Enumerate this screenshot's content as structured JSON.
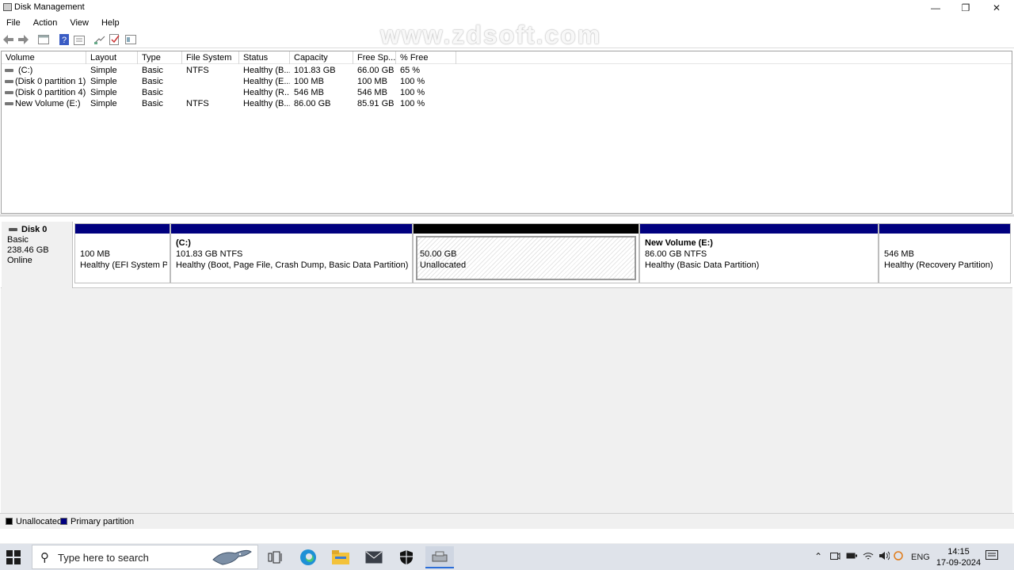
{
  "window": {
    "title": "Disk Management",
    "minimize": "—",
    "restore": "❐",
    "close": "✕"
  },
  "menu": [
    "File",
    "Action",
    "View",
    "Help"
  ],
  "watermark": "www.zdsoft.com",
  "volume_table": {
    "columns": [
      "Volume",
      "Layout",
      "Type",
      "File System",
      "Status",
      "Capacity",
      "Free Sp...",
      "% Free"
    ],
    "rows": [
      {
        "volume": "(C:)",
        "layout": "Simple",
        "type": "Basic",
        "fs": "NTFS",
        "status": "Healthy (B...",
        "capacity": "101.83 GB",
        "free": "66.00 GB",
        "pct": "65 %"
      },
      {
        "volume": "(Disk 0 partition 1)",
        "layout": "Simple",
        "type": "Basic",
        "fs": "",
        "status": "Healthy (E...",
        "capacity": "100 MB",
        "free": "100 MB",
        "pct": "100 %"
      },
      {
        "volume": "(Disk 0 partition 4)",
        "layout": "Simple",
        "type": "Basic",
        "fs": "",
        "status": "Healthy (R...",
        "capacity": "546 MB",
        "free": "546 MB",
        "pct": "100 %"
      },
      {
        "volume": "New Volume (E:)",
        "layout": "Simple",
        "type": "Basic",
        "fs": "NTFS",
        "status": "Healthy (B...",
        "capacity": "86.00 GB",
        "free": "85.91 GB",
        "pct": "100 %"
      }
    ]
  },
  "disk": {
    "name": "Disk 0",
    "type": "Basic",
    "size": "238.46 GB",
    "state": "Online",
    "partitions": [
      {
        "name": "",
        "size": "100 MB",
        "status": "Healthy (EFI System Part",
        "kind": "primary"
      },
      {
        "name": "(C:)",
        "size": "101.83 GB NTFS",
        "status": "Healthy (Boot, Page File, Crash Dump, Basic Data Partition)",
        "kind": "primary"
      },
      {
        "name": "",
        "size": "50.00 GB",
        "status": "Unallocated",
        "kind": "unallocated"
      },
      {
        "name": "New Volume  (E:)",
        "size": "86.00 GB NTFS",
        "status": "Healthy (Basic Data Partition)",
        "kind": "primary"
      },
      {
        "name": "",
        "size": "546 MB",
        "status": "Healthy (Recovery Partition)",
        "kind": "primary"
      }
    ]
  },
  "legend": [
    {
      "label": "Unallocated",
      "color": "#000000"
    },
    {
      "label": "Primary partition",
      "color": "#00007f"
    }
  ],
  "taskbar": {
    "search_placeholder": "Type here to search",
    "apps": [
      "task-view-icon",
      "edge-icon",
      "file-explorer-icon",
      "mail-icon",
      "security-icon",
      "disk-management-icon"
    ],
    "tray": {
      "language": "ENG",
      "time": "14:15",
      "date": "17-09-2024"
    }
  },
  "colors": {
    "primary_partition": "#00007f",
    "unallocated": "#000000",
    "taskbar": "#dfe3ea"
  }
}
